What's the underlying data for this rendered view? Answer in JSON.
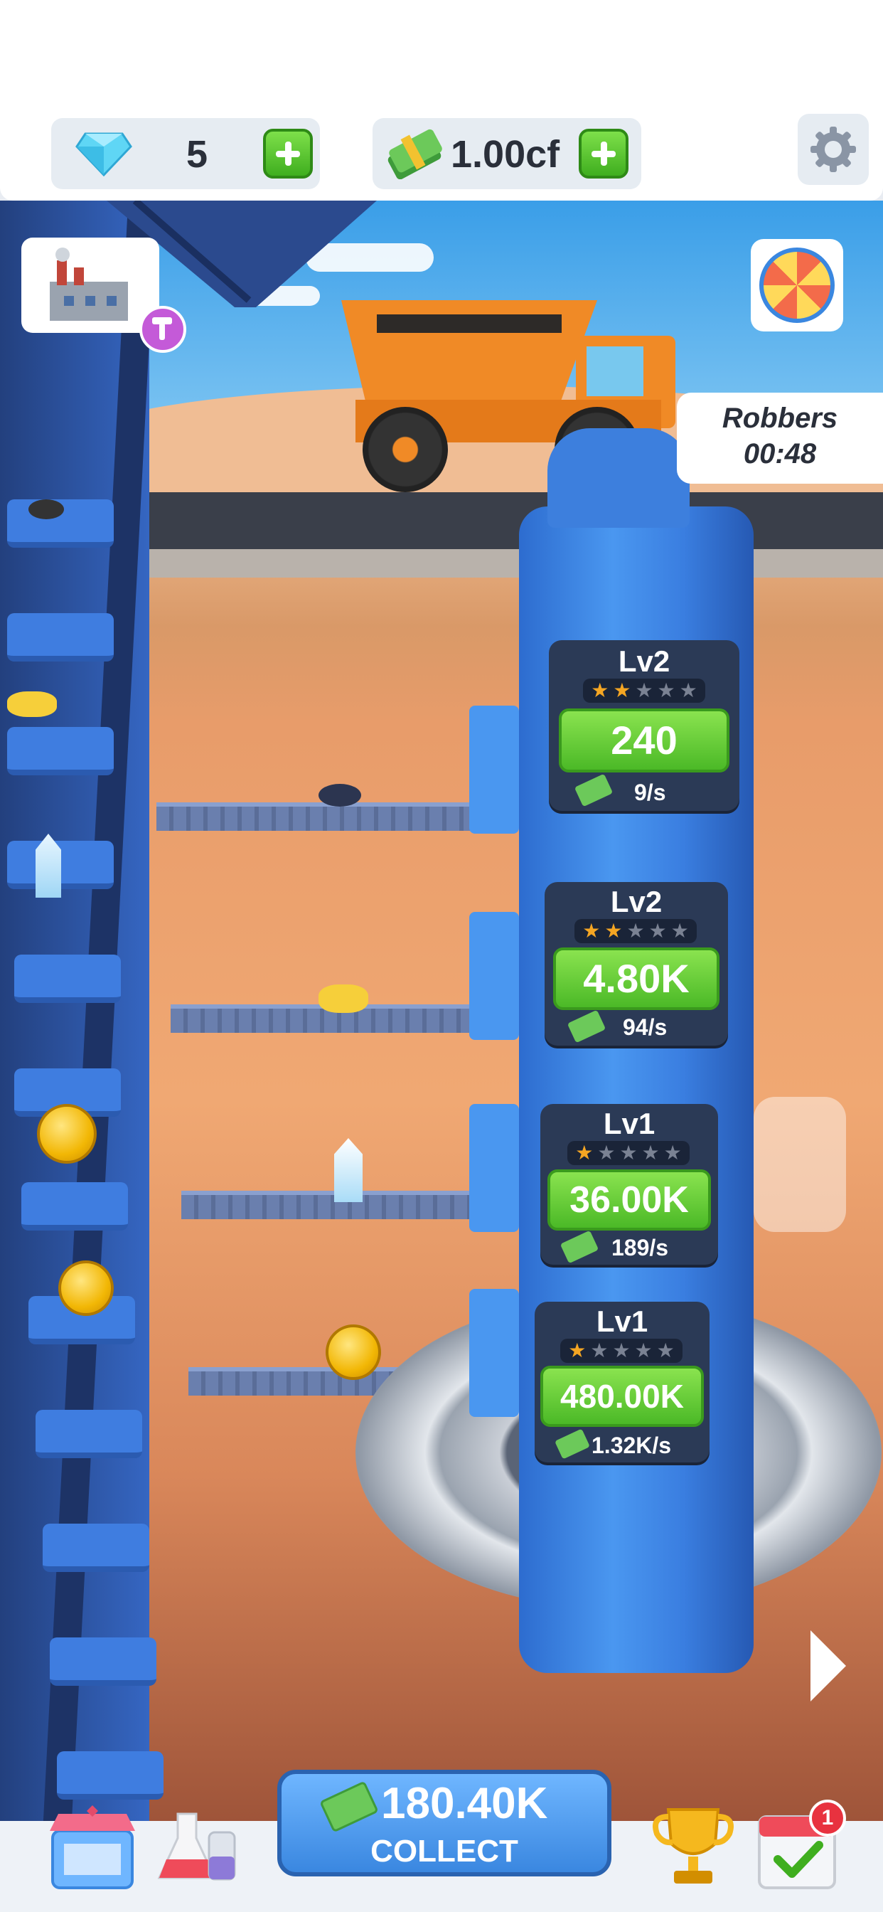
{
  "currency": {
    "gems": "5",
    "cash": "1.00cf"
  },
  "event": {
    "title": "Robbers",
    "timer": "00:48"
  },
  "drills": [
    {
      "level": "Lv2",
      "stars": 2,
      "value": "240",
      "rate": "9/s"
    },
    {
      "level": "Lv2",
      "stars": 2,
      "value": "4.80K",
      "rate": "94/s"
    },
    {
      "level": "Lv1",
      "stars": 1,
      "value": "36.00K",
      "rate": "189/s"
    },
    {
      "level": "Lv1",
      "stars": 1,
      "value": "480.00K",
      "rate": "1.32K/s"
    }
  ],
  "collect": {
    "amount": "180.40K",
    "label": "COLLECT"
  },
  "notifications": {
    "calendar_badge": "1"
  },
  "colors": {
    "accent_green": "#4bb927",
    "panel_dark": "#2b3a56",
    "button_blue": "#3a87e0",
    "star_gold": "#f5a623"
  }
}
